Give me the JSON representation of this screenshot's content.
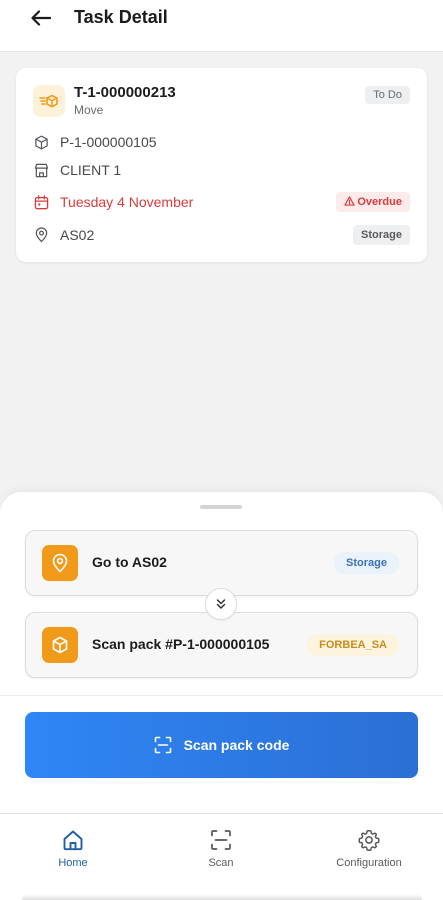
{
  "header": {
    "title": "Task Detail",
    "back_icon": "arrow-left-icon"
  },
  "task": {
    "id": "T-1-000000213",
    "type": "Move",
    "status": "To Do",
    "pack": "P-1-000000105",
    "client": "CLIENT  1",
    "due_date": "Tuesday 4 November",
    "overdue_label": "Overdue",
    "location": "AS02",
    "location_type": "Storage"
  },
  "steps": [
    {
      "label": "Go to AS02",
      "badge": "Storage",
      "icon": "location-pin-icon"
    },
    {
      "label": "Scan pack #P-1-000000105",
      "badge": "FORBEA_SA",
      "icon": "package-icon"
    }
  ],
  "scan_button": {
    "label": "Scan pack code",
    "icon": "scan-frame-icon"
  },
  "tabs": [
    {
      "label": "Home",
      "icon": "home-icon",
      "active": true
    },
    {
      "label": "Scan",
      "icon": "scan-icon",
      "active": false
    },
    {
      "label": "Configuration",
      "icon": "gear-icon",
      "active": false
    }
  ],
  "colors": {
    "accent": "#2f86f6",
    "danger": "#d93c3c",
    "step_icon": "#f19a1a",
    "active_tab": "#1e5fa8"
  }
}
